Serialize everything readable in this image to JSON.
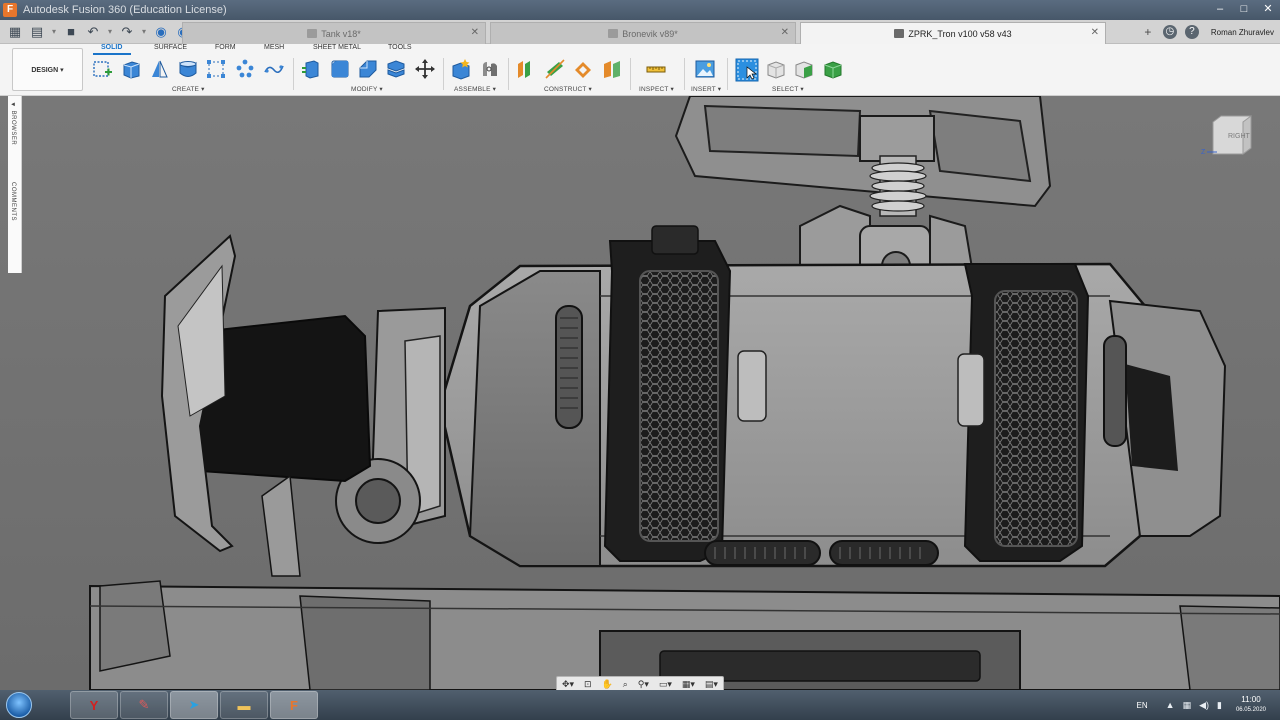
{
  "window": {
    "title": "Autodesk Fusion 360 (Education License)",
    "logo_letter": "F",
    "controls": {
      "minimize": "–",
      "maximize": "□",
      "close": "✕"
    }
  },
  "quick_access": {
    "grid_icon": "grid-icon",
    "file_icon": "file-menu-icon",
    "save_icon": "save-icon",
    "undo_icon": "undo-icon",
    "redo_icon": "redo-icon"
  },
  "tabs": [
    {
      "label": "Tank v18*",
      "active": false
    },
    {
      "label": "Bronevik v89*",
      "active": false
    },
    {
      "label": "ZPRK_Tron v100 v58 v43",
      "active": true
    }
  ],
  "header_right": {
    "user_name": "Roman Zhuravlev",
    "new_tab": "+"
  },
  "ribbon": {
    "workspace": "DESIGN ▾",
    "tabs": [
      "SOLID",
      "SURFACE",
      "FORM",
      "MESH",
      "SHEET METAL",
      "TOOLS"
    ],
    "active_tab": "SOLID",
    "groups": [
      "CREATE ▾",
      "MODIFY ▾",
      "ASSEMBLE ▾",
      "CONSTRUCT ▾",
      "INSPECT ▾",
      "INSERT ▾",
      "SELECT ▾"
    ]
  },
  "browser": {
    "browser_label": "◄ BROWSER",
    "comments_label": "COMMENTS"
  },
  "viewcube": {
    "face_label": "RIGHT",
    "z_label": "Z"
  },
  "taskbar": {
    "language": "EN",
    "time": "11:00",
    "date": "06.05.2020"
  },
  "colors": {
    "accent": "#1a74c9",
    "title_bar": "#4f6175",
    "viewport": "#737373"
  }
}
